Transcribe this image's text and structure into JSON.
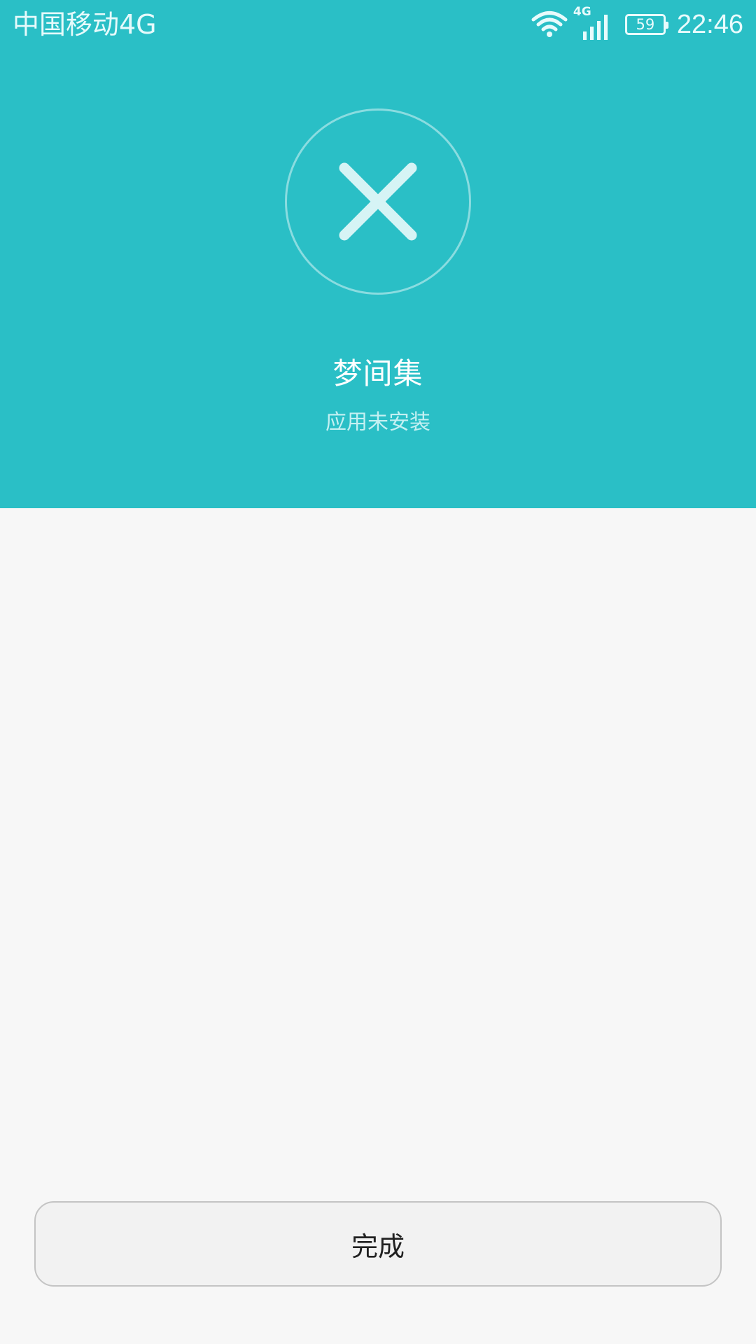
{
  "status_bar": {
    "carrier": "中国移动4G",
    "network_type": "4G",
    "battery_level": "59",
    "time": "22:46",
    "icons": [
      "wifi-icon",
      "signal-icon",
      "battery-icon"
    ]
  },
  "header": {
    "status_icon": "close-icon",
    "app_name": "梦间集",
    "install_status": "应用未安装"
  },
  "footer": {
    "done_label": "完成"
  },
  "colors": {
    "accent": "#2abfc6",
    "background": "#f7f7f7",
    "button_background": "#f2f2f2"
  }
}
